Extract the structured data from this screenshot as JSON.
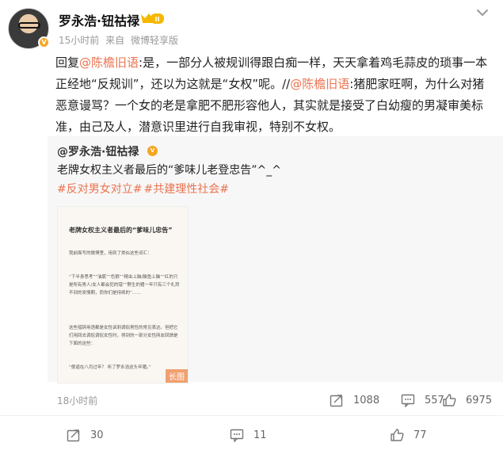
{
  "author": {
    "name": "罗永浩·钮祜禄",
    "badge_level": "II"
  },
  "meta": {
    "time": "15小时前",
    "from": "来自",
    "source": "微博轻享版"
  },
  "post": {
    "reply_prefix": "回复",
    "mention1": "@陈檐旧语",
    "part1": ":是，一部分人被规训得跟白痴一样，天天拿着鸡毛蒜皮的琐事一本正经地“反规训”，还以为这就是“女权”呢。//",
    "mention2": "@陈檐旧语",
    "part2": ":猪肥家旺啊，为什么对猪恶意谩骂？一个女的老是拿肥不肥形容他人，其实就是接受了白幼瘦的男凝审美标准，由己及人，潜意识里进行自我审视，特别不女权。"
  },
  "repost": {
    "author": "@罗永浩·钮祜禄",
    "text": "老牌女权主义者最后的“爹味儿老登忠告”^_^",
    "tags": [
      "#反对男女对立#",
      "#共建理性社会#"
    ],
    "image": {
      "title": "老牌女权主义者最后的“爹味儿忠告”",
      "p1": "我前面写的微博里，用到了类似这些词汇：",
      "p2": "“下半身思考”“油腻”“色狼”“精虫上脑/臊鱼上脑”“红的只是所有男人/女人都会犯的错”“野生的猪一年只有三个礼拜不到的发情期，而你们是持续的”……",
      "p3": "这些措辞用语都是女性讽刺调侃男性的常见表达。但把它们用回去调侃调侃女性时，得到的一部分女性网友回馈是下面的这些：",
      "p4": "“傻逼在八月过年？ 听了罗永浩这头年猪。”",
      "long_label": "长图"
    },
    "time": "18小时前",
    "share_count": "1088",
    "comment_count": "557",
    "like_count": "6975"
  },
  "footer": {
    "share_count": "30",
    "comment_count": "11",
    "like_count": "77"
  }
}
